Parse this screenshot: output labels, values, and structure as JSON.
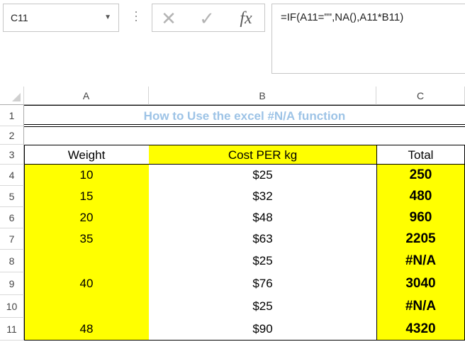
{
  "formula_bar": {
    "name_box": "C11",
    "name_box_arrow": "▼",
    "cancel_glyph": "✕",
    "enter_glyph": "✓",
    "fx_glyph": "fx",
    "formula": "=IF(A11=\"\",NA(),A11*B11)"
  },
  "columns": [
    {
      "label": "A"
    },
    {
      "label": "B"
    },
    {
      "label": "C"
    }
  ],
  "rows": [
    "1",
    "2",
    "3",
    "4",
    "5",
    "6",
    "7",
    "8",
    "9",
    "10",
    "11"
  ],
  "sheet": {
    "title": "How to Use the excel #N/A function",
    "headers": {
      "a": "Weight",
      "b": "Cost PER kg",
      "c": "Total"
    },
    "data": [
      {
        "a": "10",
        "b": "$25",
        "c": "250"
      },
      {
        "a": "15",
        "b": "$32",
        "c": "480"
      },
      {
        "a": "20",
        "b": "$48",
        "c": "960"
      },
      {
        "a": "35",
        "b": "$63",
        "c": "2205"
      },
      {
        "a": "",
        "b": "$25",
        "c": "#N/A"
      },
      {
        "a": "40",
        "b": "$76",
        "c": "3040"
      },
      {
        "a": "",
        "b": "$25",
        "c": "#N/A"
      },
      {
        "a": "48",
        "b": "$90",
        "c": "4320"
      }
    ]
  },
  "colors": {
    "highlight": "#ffff00",
    "title": "#9dc3e6"
  }
}
